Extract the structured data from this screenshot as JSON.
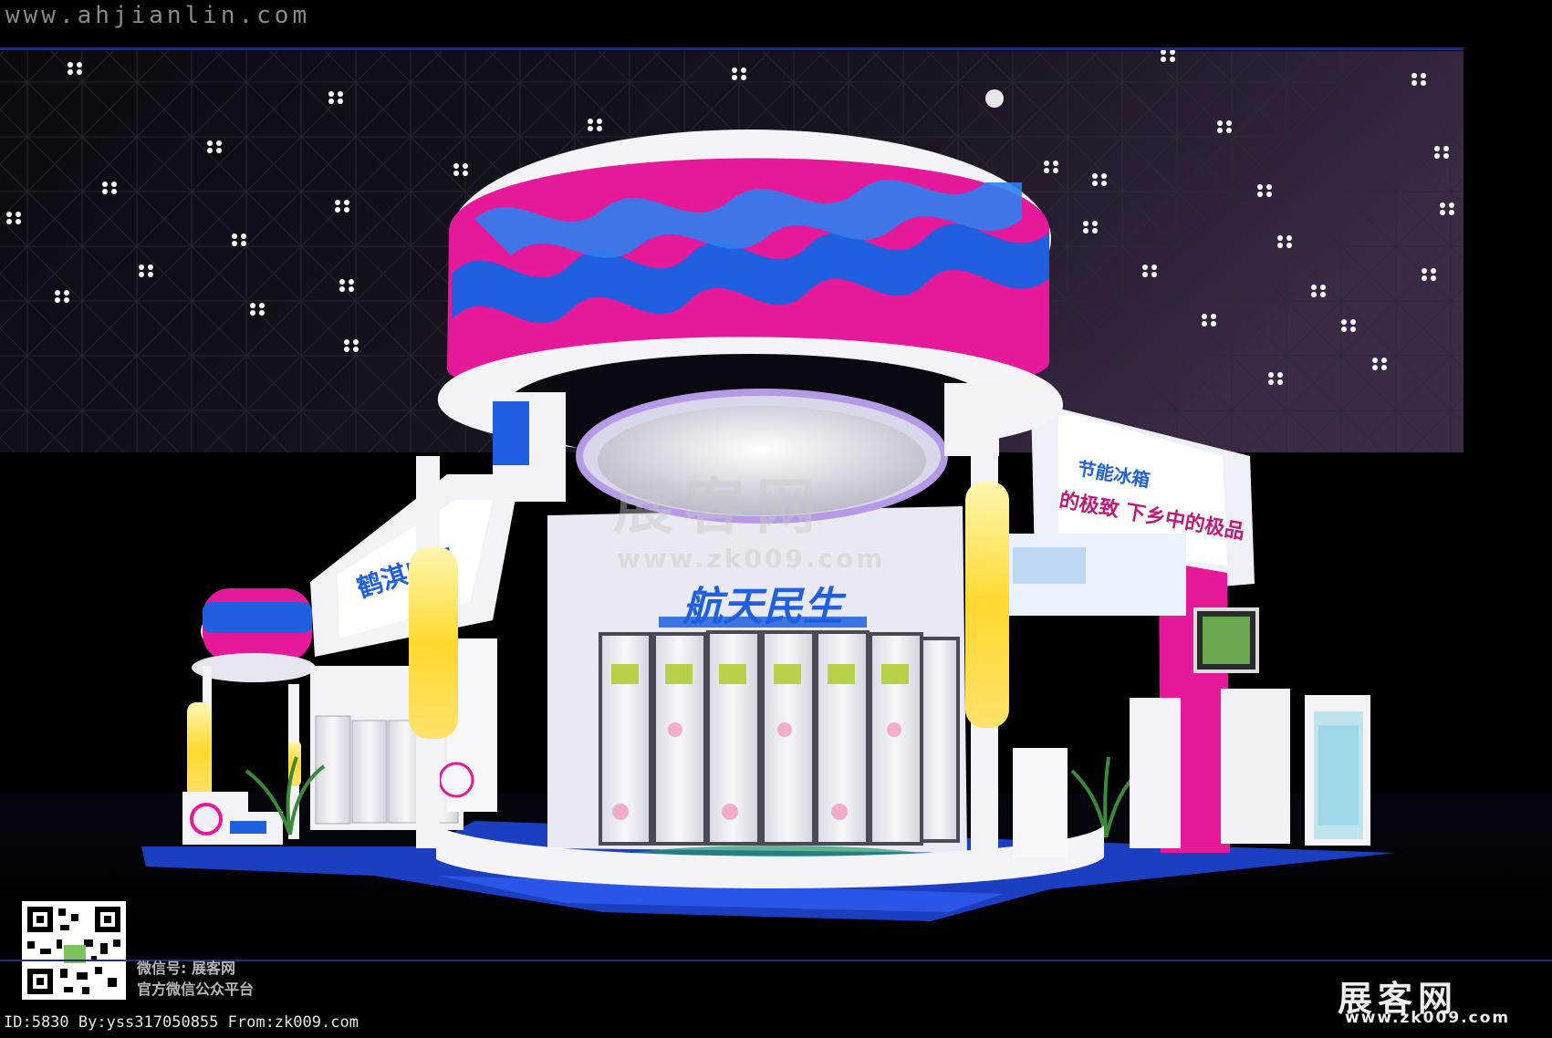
{
  "header": {
    "site_url": "www.ahjianlin.com"
  },
  "booth": {
    "brand_main": "航天民生",
    "brand_left": "鹤淇电器",
    "slogan_top": "节能冰箱",
    "slogan_mid": "的极致   下乡中的极品",
    "watermark_cn": "展客网",
    "watermark_url": "www.zk009.com"
  },
  "footer": {
    "id_line": "ID:5830 By:yss317050855 From:zk009.com",
    "wechat_id": "微信号: 展客网",
    "wechat_desc": "官方微信公众平台",
    "brand_cn": "展客网",
    "brand_url": "www.zk009.com"
  },
  "colors": {
    "background": "#000000",
    "magenta": "#e5199a",
    "blue": "#1f5fe0",
    "white": "#f2f2f7",
    "floor_blue": "#1b3fc0",
    "light_yellow": "#ffe85a"
  },
  "icons": [
    "qr-code-icon",
    "ceiling-spotlight-icon"
  ]
}
